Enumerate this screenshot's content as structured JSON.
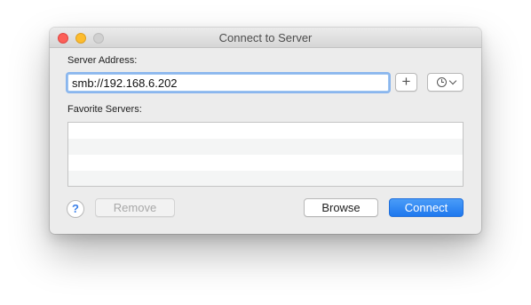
{
  "window": {
    "title": "Connect to Server"
  },
  "server_address": {
    "label": "Server Address:",
    "value": "smb://192.168.6.202"
  },
  "buttons": {
    "add": "+",
    "help": "?",
    "remove": "Remove",
    "browse": "Browse",
    "connect": "Connect"
  },
  "favorites": {
    "label": "Favorite Servers:",
    "items": []
  },
  "colors": {
    "accent": "#2f8af5",
    "close": "#fc5f57",
    "minimize": "#fdbc2e",
    "zoom_disabled": "#d0d0d0"
  },
  "icons": {
    "recent_servers": "clock-icon",
    "recent_dropdown": "chevron-down-icon"
  }
}
